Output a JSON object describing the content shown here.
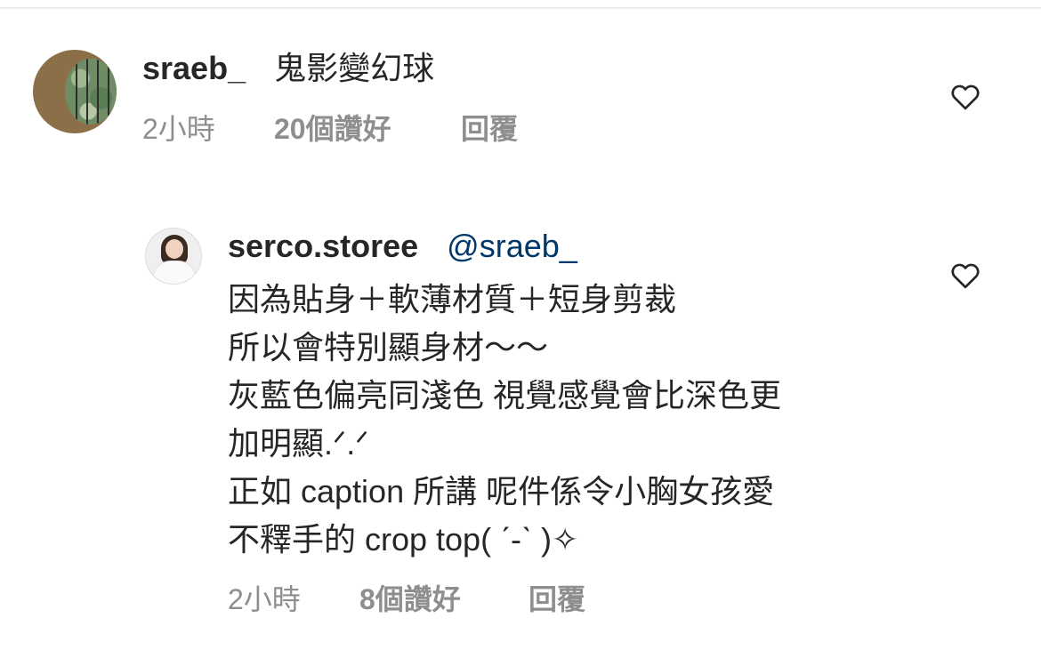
{
  "comment": {
    "username": "sraeb_",
    "text": "鬼影變幻球",
    "time": "2小時",
    "likes": "20個讚好",
    "reply": "回覆",
    "heart_icon": "heart-outline-icon"
  },
  "reply": {
    "username": "serco.storee",
    "mention": "@sraeb_",
    "lines": [
      "因為貼身＋軟薄材質＋短身剪裁",
      "所以會特別顯身材～～",
      "灰藍色偏亮同淺色 視覺感覺會比深色更",
      "加明顯.ᐟ.ᐟ",
      "正如 caption 所講 呢件係令小胸女孩愛",
      "不釋手的 crop top( ˊ-ˋ )✧"
    ],
    "time": "2小時",
    "likes": "8個讚好",
    "reply": "回覆",
    "heart_icon": "heart-outline-icon"
  },
  "colors": {
    "text": "#262626",
    "muted": "#8e8e8e",
    "mention": "#00376b"
  }
}
